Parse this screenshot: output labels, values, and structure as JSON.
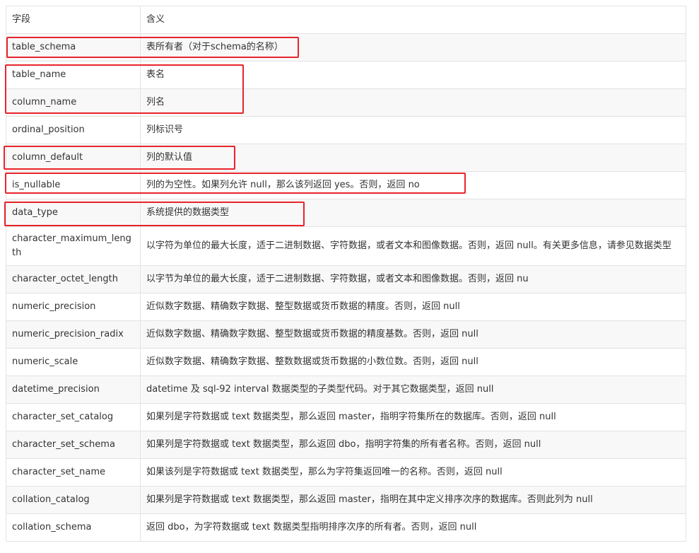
{
  "header": {
    "field": "字段",
    "meaning": "含义"
  },
  "rows": [
    {
      "field": "table_schema",
      "meaning": "表所有者（对于schema的名称）"
    },
    {
      "field": "table_name",
      "meaning": "表名"
    },
    {
      "field": "column_name",
      "meaning": "列名"
    },
    {
      "field": "ordinal_position",
      "meaning": "列标识号"
    },
    {
      "field": "column_default",
      "meaning": "列的默认值"
    },
    {
      "field": "is_nullable",
      "meaning": "列的为空性。如果列允许 null，那么该列返回 yes。否则，返回 no"
    },
    {
      "field": "data_type",
      "meaning": "系统提供的数据类型"
    },
    {
      "field": "character_maximum_length",
      "meaning": "以字符为单位的最大长度，适于二进制数据、字符数据，或者文本和图像数据。否则，返回 null。有关更多信息，请参见数据类型"
    },
    {
      "field": "character_octet_length",
      "meaning": "以字节为单位的最大长度，适于二进制数据、字符数据，或者文本和图像数据。否则，返回 nu"
    },
    {
      "field": "numeric_precision",
      "meaning": "近似数字数据、精确数字数据、整型数据或货币数据的精度。否则，返回 null"
    },
    {
      "field": "numeric_precision_radix",
      "meaning": "近似数字数据、精确数字数据、整型数据或货币数据的精度基数。否则，返回 null"
    },
    {
      "field": "numeric_scale",
      "meaning": "近似数字数据、精确数字数据、整数数据或货币数据的小数位数。否则，返回 null"
    },
    {
      "field": "datetime_precision",
      "meaning": "datetime 及 sql-92 interval 数据类型的子类型代码。对于其它数据类型，返回 null"
    },
    {
      "field": "character_set_catalog",
      "meaning": "如果列是字符数据或 text 数据类型，那么返回 master，指明字符集所在的数据库。否则，返回 null"
    },
    {
      "field": "character_set_schema",
      "meaning": "如果列是字符数据或 text 数据类型，那么返回 dbo，指明字符集的所有者名称。否则，返回 null"
    },
    {
      "field": "character_set_name",
      "meaning": "如果该列是字符数据或 text 数据类型，那么为字符集返回唯一的名称。否则，返回 null"
    },
    {
      "field": "collation_catalog",
      "meaning": "如果列是字符数据或 text 数据类型，那么返回 master，指明在其中定义排序次序的数据库。否则此列为 null"
    },
    {
      "field": "collation_schema",
      "meaning": "返回 dbo，为字符数据或 text 数据类型指明排序次序的所有者。否则，返回 null"
    }
  ],
  "annotation_color": "#e8242c"
}
